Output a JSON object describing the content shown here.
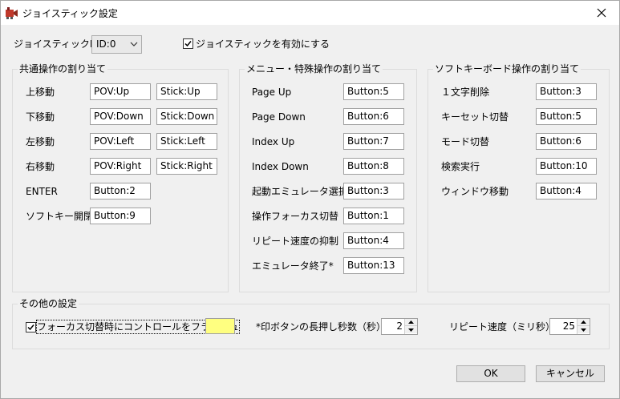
{
  "window": {
    "title": "ジョイスティック設定"
  },
  "top": {
    "id_label": "ジョイスティックID",
    "id_value": "ID:0",
    "enable_label": "ジョイスティックを有効にする",
    "enable_checked": true
  },
  "common": {
    "title": "共通操作の割り当て",
    "rows": [
      {
        "label": "上移動",
        "a": "POV:Up",
        "b": "Stick:Up"
      },
      {
        "label": "下移動",
        "a": "POV:Down",
        "b": "Stick:Down"
      },
      {
        "label": "左移動",
        "a": "POV:Left",
        "b": "Stick:Left"
      },
      {
        "label": "右移動",
        "a": "POV:Right",
        "b": "Stick:Right"
      },
      {
        "label": "ENTER",
        "a": "Button:2"
      },
      {
        "label": "ソフトキー開閉",
        "a": "Button:9"
      }
    ]
  },
  "menu": {
    "title": "メニュー・特殊操作の割り当て",
    "rows": [
      {
        "label": "Page Up",
        "a": "Button:5"
      },
      {
        "label": "Page Down",
        "a": "Button:6"
      },
      {
        "label": "Index Up",
        "a": "Button:7"
      },
      {
        "label": "Index Down",
        "a": "Button:8"
      },
      {
        "label": "起動エミュレータ選択",
        "a": "Button:3"
      },
      {
        "label": "操作フォーカス切替",
        "a": "Button:1"
      },
      {
        "label": "リピート速度の抑制",
        "a": "Button:4"
      },
      {
        "label": "エミュレータ終了*",
        "a": "Button:13"
      }
    ]
  },
  "softkb": {
    "title": "ソフトキーボード操作の割り当て",
    "rows": [
      {
        "label": "１文字削除",
        "a": "Button:3"
      },
      {
        "label": "キーセット切替",
        "a": "Button:5"
      },
      {
        "label": "モード切替",
        "a": "Button:6"
      },
      {
        "label": "検索実行",
        "a": "Button:10"
      },
      {
        "label": "ウィンドウ移動",
        "a": "Button:4"
      }
    ]
  },
  "other": {
    "title": "その他の設定",
    "flash_label": "フォーカス切替時にコントロールをフラッシュ",
    "flash_checked": true,
    "flash_color": "#ffff80",
    "hold_label": "*印ボタンの長押し秒数（秒）",
    "hold_value": "2",
    "repeat_label": "リピート速度（ミリ秒）",
    "repeat_value": "25"
  },
  "buttons": {
    "ok": "OK",
    "cancel": "キャンセル"
  }
}
